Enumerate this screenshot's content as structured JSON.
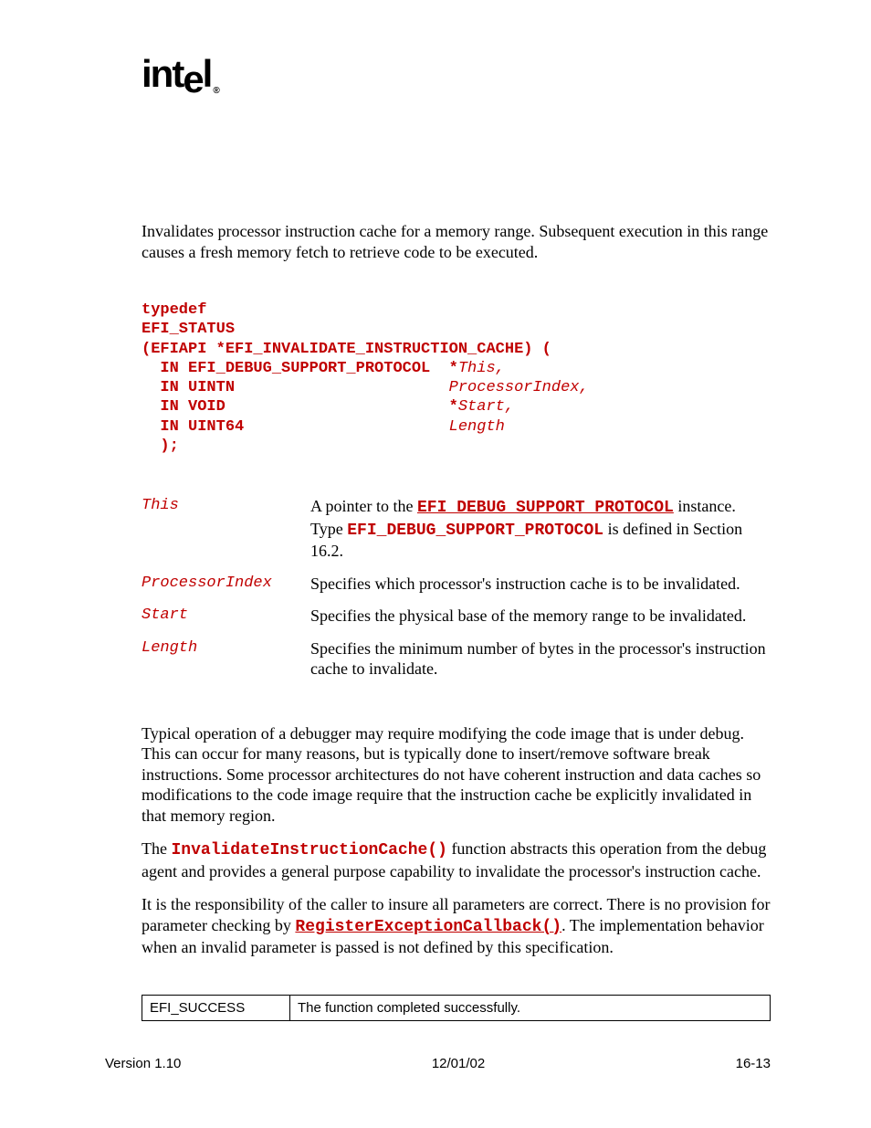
{
  "logo_text": "intel",
  "summary": "Invalidates processor instruction cache for a memory range.  Subsequent execution in this range causes a fresh memory fetch to retrieve code to be executed.",
  "prototype": {
    "l1": "typedef",
    "l2": "EFI_STATUS",
    "l3": "(EFIAPI *EFI_INVALIDATE_INSTRUCTION_CACHE) (",
    "l4a": "  IN EFI_DEBUG_SUPPORT_PROTOCOL  *",
    "l4b": "This,",
    "l5a": "  IN UINTN                       ",
    "l5b": "ProcessorIndex,",
    "l6a": "  IN VOID                        *",
    "l6b": "Start,",
    "l7a": "  IN UINT64                      ",
    "l7b": "Length",
    "l8": "  );"
  },
  "params": [
    {
      "name": "This",
      "desc_pre": "A pointer to the ",
      "desc_link": "EFI_DEBUG_SUPPORT_PROTOCOL",
      "desc_mid": " instance. Type ",
      "desc_code": "EFI_DEBUG_SUPPORT_PROTOCOL",
      "desc_post": " is defined in Section 16.2."
    },
    {
      "name": "ProcessorIndex",
      "desc": "Specifies which processor's instruction cache is to be invalidated."
    },
    {
      "name": "Start",
      "desc": "Specifies the physical base of the memory range to be invalidated."
    },
    {
      "name": "Length",
      "desc": "Specifies the minimum number of bytes in the processor's instruction cache to invalidate."
    }
  ],
  "description": {
    "p1": "Typical operation of a debugger may require modifying the code image that is under debug.  This can occur for many reasons, but is typically done to insert/remove software break instructions.  Some processor architectures do not have coherent instruction and data caches so modifications to the code image require that the instruction cache be explicitly invalidated in that memory region.",
    "p2_pre": "The ",
    "p2_code": "InvalidateInstructionCache()",
    "p2_post": " function abstracts this operation from the debug agent and provides a general purpose capability to invalidate the processor's instruction cache.",
    "p3_pre": "It is the responsibility of the caller to insure all parameters are correct.  There is no provision for parameter checking by ",
    "p3_code": "RegisterExceptionCallback()",
    "p3_post": ".  The implementation behavior when an invalid parameter is passed is not defined by this specification."
  },
  "status": [
    {
      "code": "EFI_SUCCESS",
      "desc": "The function completed successfully."
    }
  ],
  "footer": {
    "left": "Version 1.10",
    "center": "12/01/02",
    "right": "16-13"
  }
}
